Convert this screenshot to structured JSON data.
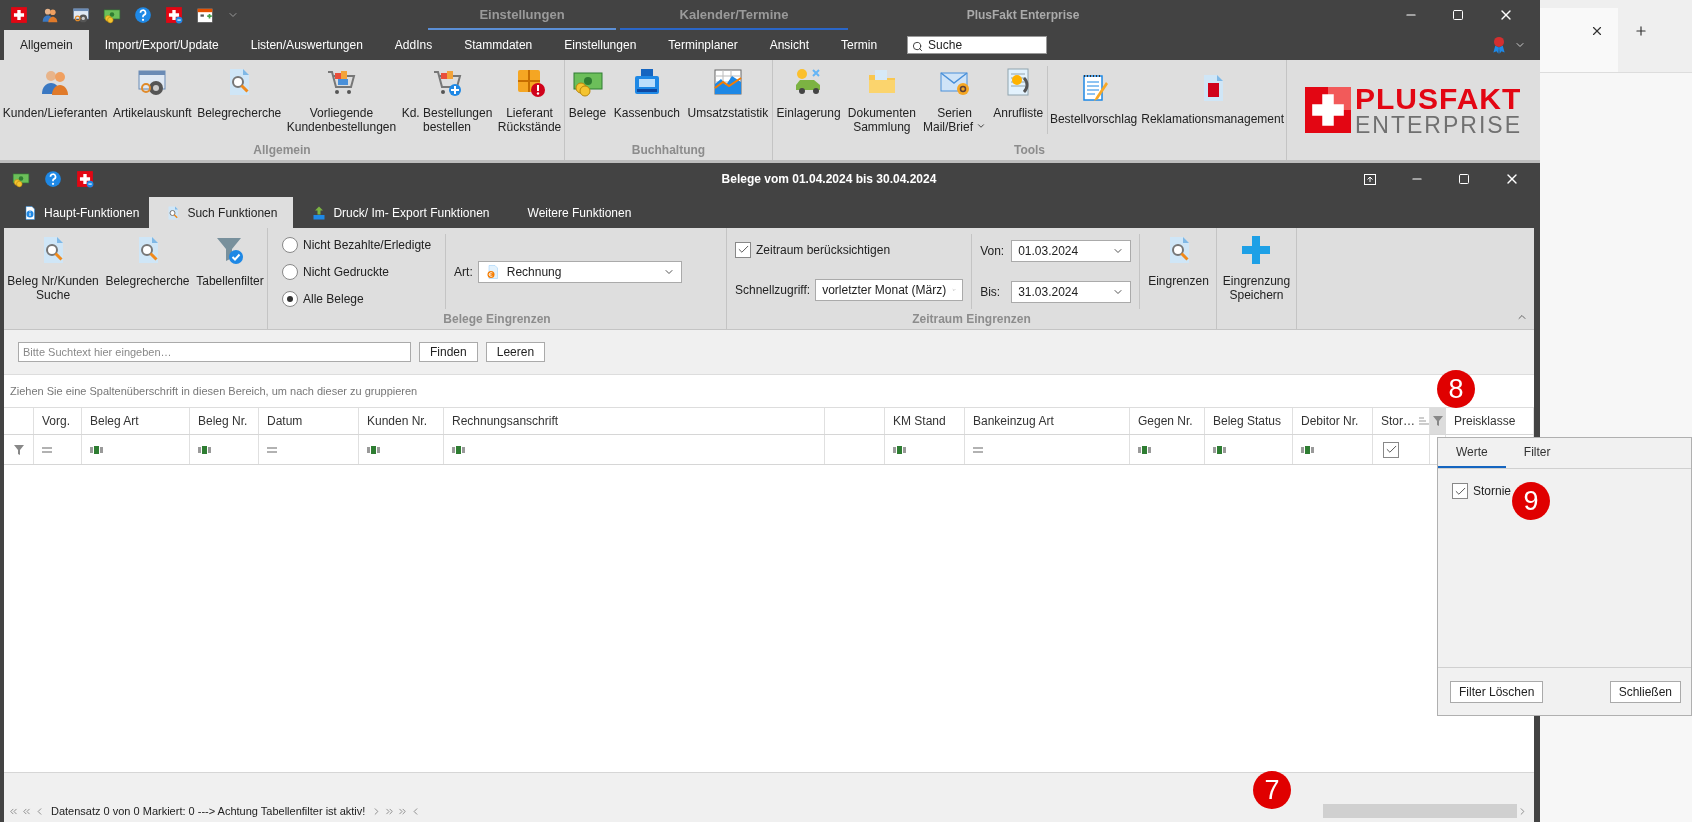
{
  "title_bar": {
    "context_tabs": [
      {
        "label": "Einstellungen"
      },
      {
        "label": "Kalender/Termine"
      }
    ],
    "title": "PlusFakt Enterprise"
  },
  "ribbon": {
    "tabs": [
      {
        "label": "Allgemein",
        "selected": true
      },
      {
        "label": "Import/Export/Update",
        "selected": false
      },
      {
        "label": "Listen/Auswertungen",
        "selected": false
      },
      {
        "label": "AddIns",
        "selected": false
      },
      {
        "label": "Stammdaten",
        "selected": false
      },
      {
        "label": "Einstellungen",
        "selected": false
      },
      {
        "label": "Terminplaner",
        "selected": false
      },
      {
        "label": "Ansicht",
        "selected": false
      },
      {
        "label": "Termin",
        "selected": false
      }
    ],
    "search": {
      "placeholder": "Suche"
    },
    "groups": [
      {
        "caption": "Allgemein",
        "sections": [
          [
            {
              "label": "Kunden/Lieferanten",
              "menu": false
            },
            {
              "label": "Artikelauskunft",
              "menu": false
            },
            {
              "label": "Belegrecherche",
              "menu": false
            },
            {
              "label": "Vorliegende\nKundenbestellungen",
              "menu": false
            },
            {
              "label": "Kd. Bestellungen\nbestellen",
              "menu": false
            },
            {
              "label": "Lieferant\nRückstände",
              "menu": false
            }
          ]
        ]
      },
      {
        "caption": "Buchhaltung",
        "sections": [
          [
            {
              "label": "Belege",
              "menu": false
            },
            {
              "label": "Kassenbuch",
              "menu": false
            },
            {
              "label": "Umsatzstatistik",
              "menu": false
            }
          ]
        ]
      },
      {
        "caption": "Tools",
        "sections": [
          [
            {
              "label": "Einlagerung",
              "menu": false
            },
            {
              "label": "Dokumenten\nSammlung",
              "menu": false
            },
            {
              "label": "Serien\nMail/Brief",
              "menu": true
            },
            {
              "label": "Anrufliste",
              "menu": false
            }
          ],
          [
            {
              "label": "Bestellvorschlag",
              "menu": false
            },
            {
              "label": "Reklamationsmanagement",
              "menu": false
            }
          ]
        ]
      }
    ],
    "logo": {
      "line_1": "PLUSFAKT",
      "line_2": "ENTERPRISE"
    }
  },
  "document_window": {
    "title": "Belege vom 01.04.2024 bis 30.04.2024",
    "tabs": [
      {
        "label": "Haupt-Funktionen",
        "selected": false
      },
      {
        "label": "Such Funktionen",
        "selected": true
      },
      {
        "label": "Druck/ Im- Export Funktionen",
        "selected": false
      },
      {
        "label": "Weitere Funktionen",
        "selected": false
      }
    ],
    "search_buttons": [
      {
        "label": "Beleg Nr/Kunden\nSuche"
      },
      {
        "label": "Belegrecherche"
      },
      {
        "label": "Tabellenfilter"
      }
    ],
    "belege": {
      "caption": "Belege Eingrenzen",
      "radios": [
        {
          "label": "Nicht Bezahlte/Erledigte",
          "selected": false
        },
        {
          "label": "Nicht Gedruckte",
          "selected": false
        },
        {
          "label": "Alle Belege",
          "selected": true
        }
      ],
      "art": {
        "label": "Art:",
        "value": "Rechnung"
      }
    },
    "zeitraum": {
      "caption": "Zeitraum Eingrenzen",
      "use_period": {
        "label": "Zeitraum berücksichtigen",
        "checked": true
      },
      "quick": {
        "label": "Schnellzugriff:",
        "value": "vorletzter Monat (März)"
      },
      "from": {
        "label": "Von:",
        "value": "01.03.2024"
      },
      "to": {
        "label": "Bis:",
        "value": "31.03.2024"
      },
      "apply": {
        "label": "Eingrenzen"
      }
    },
    "save": {
      "label": "Eingrenzung\nSpeichern"
    },
    "search": {
      "placeholder": "Bitte Suchtext hier eingeben…",
      "buttons": [
        {
          "label": "Finden"
        },
        {
          "label": "Leeren"
        }
      ]
    },
    "group_hint": "Ziehen Sie eine Spaltenüberschrift in diesen Bereich, um nach dieser zu gruppieren",
    "grid": {
      "badge": "8",
      "columns": [
        {
          "kind": "funnel",
          "sorted": false
        },
        {
          "header": "Vorg.",
          "kind": "equals",
          "sorted": false
        },
        {
          "header": "Beleg Art",
          "kind": "text",
          "sorted": false
        },
        {
          "header": "Beleg Nr.",
          "kind": "text",
          "sorted": false
        },
        {
          "header": "Datum",
          "kind": "equals",
          "sorted": false
        },
        {
          "header": "Kunden Nr.",
          "kind": "text",
          "sorted": false
        },
        {
          "header": "Rechnungsanschrift",
          "kind": "text",
          "sorted": false
        },
        {
          "kind": "blank",
          "sorted": false
        },
        {
          "header": "KM Stand",
          "kind": "text",
          "sorted": false
        },
        {
          "header": "Bankeinzug Art",
          "kind": "equals",
          "sorted": false
        },
        {
          "header": "Gegen Nr.",
          "kind": "text",
          "sorted": false
        },
        {
          "header": "Beleg Status",
          "kind": "text",
          "sorted": false
        },
        {
          "header": "Debitor Nr.",
          "kind": "text",
          "sorted": false
        },
        {
          "header": "Stor…",
          "kind": "check",
          "checked": true,
          "sorted": true
        },
        {
          "kind": "filter_button"
        },
        {
          "header": "Preisklasse",
          "kind": "blank",
          "sorted": false
        }
      ]
    },
    "footer": {
      "badge": "7",
      "navigator": "Datensatz 0 von 0 Markiert: 0 ---> Achtung Tabellenfilter ist aktiv!"
    }
  },
  "filter_popup": {
    "badge": "9",
    "tabs": [
      {
        "label": "Werte",
        "selected": true
      },
      {
        "label": "Filter",
        "selected": false
      }
    ],
    "values": [
      {
        "label": "Stornie",
        "checked": true
      }
    ],
    "buttons": [
      {
        "label": "Filter Löschen"
      },
      {
        "label": "Schließen"
      }
    ]
  }
}
